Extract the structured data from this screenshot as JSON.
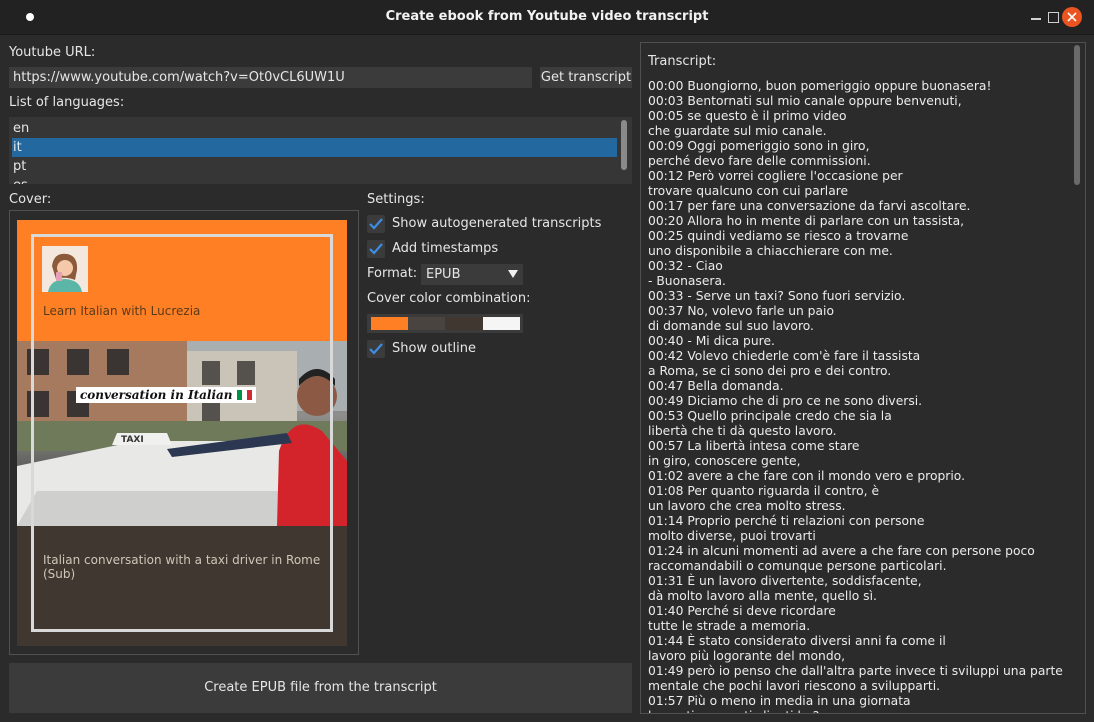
{
  "window": {
    "title": "Create ebook from Youtube video transcript"
  },
  "url": {
    "label": "Youtube URL:",
    "value": "https://www.youtube.com/watch?v=Ot0vCL6UW1U",
    "button": "Get transcript"
  },
  "languages": {
    "label": "List of languages:",
    "items": [
      "en",
      "it",
      "pt",
      "es"
    ],
    "selected": "it"
  },
  "cover": {
    "label": "Cover:",
    "author": "Learn Italian with Lucrezia",
    "overlay_text": "conversation in Italian",
    "photo_sign": "TAXI",
    "title": "Italian conversation with a taxi driver in Rome (Sub)"
  },
  "settings": {
    "label": "Settings:",
    "show_autogenerated": {
      "label": "Show autogenerated transcripts",
      "checked": true
    },
    "add_timestamps": {
      "label": "Add timestamps",
      "checked": true
    },
    "format_label": "Format:",
    "format_value": "EPUB",
    "color_label": "Cover color combination:",
    "color_swatches": [
      "#ff8024",
      "#4a4440",
      "#403830",
      "#f5f5f5"
    ],
    "show_outline": {
      "label": "Show outline",
      "checked": true
    }
  },
  "create_button": "Create EPUB file from the transcript",
  "transcript": {
    "label": "Transcript:",
    "lines": [
      "00:00 Buongiorno, buon pomeriggio oppure buonasera!",
      "00:03 Bentornati sul mio canale oppure benvenuti,",
      "00:05 se questo è il primo video",
      "che guardate sul mio canale.",
      "00:09 Oggi pomeriggio sono in giro,",
      "perché devo fare delle commissioni.",
      "00:12 Però vorrei cogliere l'occasione per",
      "trovare qualcuno con cui parlare",
      "00:17 per fare una conversazione da farvi ascoltare.",
      "00:20 Allora ho in mente di parlare con un tassista,",
      "00:25 quindi vediamo se riesco a trovarne",
      "uno disponibile a chiacchierare con me.",
      "00:32 - Ciao",
      "- Buonasera.",
      "00:33 - Serve un taxi? Sono fuori servizio.",
      "00:37 No, volevo farle un paio",
      "di domande sul suo lavoro.",
      "00:40 - Mi dica pure.",
      "00:42 Volevo chiederle com'è fare il tassista",
      "a Roma, se ci sono dei pro e dei contro.",
      "00:47 Bella domanda.",
      "00:49 Diciamo che di pro ce ne sono diversi.",
      "00:53 Quello principale credo che sia la",
      "libertà che ti dà questo lavoro.",
      "00:57 La libertà intesa come stare",
      "in giro, conoscere gente,",
      "01:02 avere a che fare con il mondo vero e proprio.",
      "01:08 Per quanto riguarda il contro, è",
      "un lavoro che crea molto stress.",
      "01:14 Proprio perché ti relazioni con persone",
      "molto diverse, puoi trovarti",
      "01:24 in alcuni momenti ad avere a che fare con persone poco",
      "raccomandabili o comunque persone particolari.",
      "01:31 È un lavoro divertente, soddisfacente,",
      "dà molto lavoro alla mente, quello sì.",
      "01:40 Perché si deve ricordare",
      "tutte le strade a memoria.",
      "01:44 È stato considerato diversi anni fa come il",
      "lavoro più logorante del mondo,",
      "01:49 però io penso che dall'altra parte invece ti sviluppi una parte",
      "mentale che pochi lavori riescono a svilupparti.",
      "01:57 Più o meno in media in una giornata",
      "lavorativa quanti clienti ha?"
    ]
  }
}
